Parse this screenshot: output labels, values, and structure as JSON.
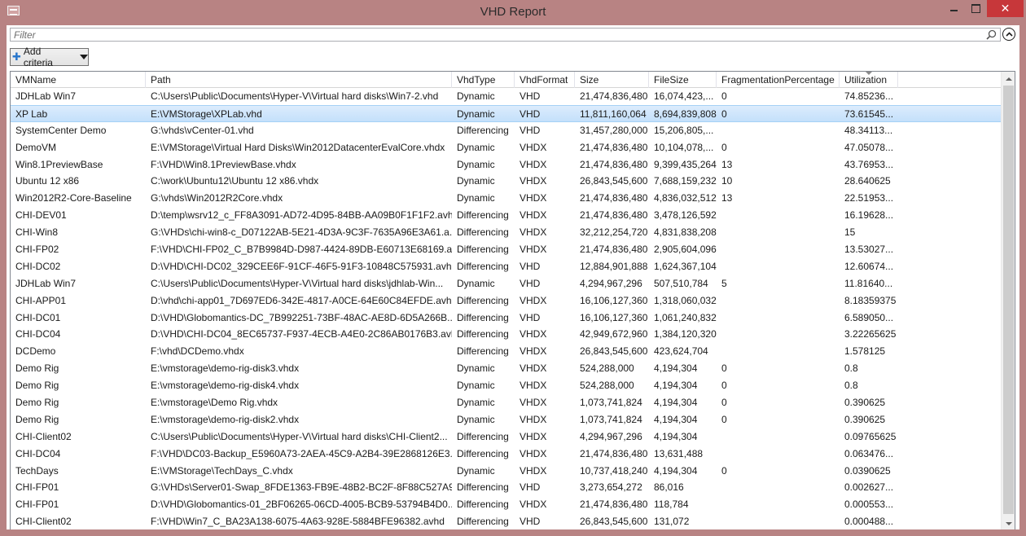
{
  "window": {
    "title": "VHD Report"
  },
  "filter": {
    "placeholder": "Filter",
    "value": ""
  },
  "toolbar": {
    "add_criteria_label": "Add criteria"
  },
  "columns": [
    "VMName",
    "Path",
    "VhdType",
    "VhdFormat",
    "Size",
    "FileSize",
    "FragmentationPercentage",
    "Utilization"
  ],
  "sort": {
    "column": "Utilization",
    "direction": "descending"
  },
  "selected_row_index": 1,
  "rows": [
    [
      "JDHLab Win7",
      "C:\\Users\\Public\\Documents\\Hyper-V\\Virtual hard disks\\Win7-2.vhd",
      "Dynamic",
      "VHD",
      "21,474,836,480",
      "16,074,423,...",
      "0",
      "74.85236..."
    ],
    [
      "XP Lab",
      "E:\\VMStorage\\XPLab.vhd",
      "Dynamic",
      "VHD",
      "11,811,160,064",
      "8,694,839,808",
      "0",
      "73.61545..."
    ],
    [
      "SystemCenter Demo",
      "G:\\vhds\\vCenter-01.vhd",
      "Differencing",
      "VHD",
      "31,457,280,000",
      "15,206,805,...",
      "",
      "48.34113..."
    ],
    [
      "DemoVM",
      "E:\\VMStorage\\Virtual Hard Disks\\Win2012DatacenterEvalCore.vhdx",
      "Dynamic",
      "VHDX",
      "21,474,836,480",
      "10,104,078,...",
      "0",
      "47.05078..."
    ],
    [
      "Win8.1PreviewBase",
      "F:\\VHD\\Win8.1PreviewBase.vhdx",
      "Dynamic",
      "VHDX",
      "21,474,836,480",
      "9,399,435,264",
      "13",
      "43.76953..."
    ],
    [
      "Ubuntu 12 x86",
      "C:\\work\\Ubuntu12\\Ubuntu 12 x86.vhdx",
      "Dynamic",
      "VHDX",
      "26,843,545,600",
      "7,688,159,232",
      "10",
      "28.640625"
    ],
    [
      "Win2012R2-Core-Baseline",
      "G:\\vhds\\Win2012R2Core.vhdx",
      "Dynamic",
      "VHDX",
      "21,474,836,480",
      "4,836,032,512",
      "13",
      "22.51953..."
    ],
    [
      "CHI-DEV01",
      "D:\\temp\\wsrv12_c_FF8A3091-AD72-4D95-84BB-AA09B0F1F1F2.avh...",
      "Differencing",
      "VHDX",
      "21,474,836,480",
      "3,478,126,592",
      "",
      "16.19628..."
    ],
    [
      "CHI-Win8",
      "G:\\VHDs\\chi-win8-c_D07122AB-5E21-4D3A-9C3F-7635A96E3A61.a...",
      "Differencing",
      "VHDX",
      "32,212,254,720",
      "4,831,838,208",
      "",
      "15"
    ],
    [
      "CHI-FP02",
      "F:\\VHD\\CHI-FP02_C_B7B9984D-D987-4424-89DB-E60713E68169.a...",
      "Differencing",
      "VHDX",
      "21,474,836,480",
      "2,905,604,096",
      "",
      "13.53027..."
    ],
    [
      "CHI-DC02",
      "D:\\VHD\\CHI-DC02_329CEE6F-91CF-46F5-91F3-10848C575931.avhd",
      "Differencing",
      "VHD",
      "12,884,901,888",
      "1,624,367,104",
      "",
      "12.60674..."
    ],
    [
      "JDHLab Win7",
      "C:\\Users\\Public\\Documents\\Hyper-V\\Virtual hard disks\\jdhlab-Win...",
      "Dynamic",
      "VHD",
      "4,294,967,296",
      "507,510,784",
      "5",
      "11.81640..."
    ],
    [
      "CHI-APP01",
      "D:\\vhd\\chi-app01_7D697ED6-342E-4817-A0CE-64E60C84EFDE.avhdx",
      "Differencing",
      "VHDX",
      "16,106,127,360",
      "1,318,060,032",
      "",
      "8.18359375"
    ],
    [
      "CHI-DC01",
      "D:\\VHD\\Globomantics-DC_7B992251-73BF-48AC-AE8D-6D5A266B...",
      "Differencing",
      "VHD",
      "16,106,127,360",
      "1,061,240,832",
      "",
      "6.589050..."
    ],
    [
      "CHI-DC04",
      "D:\\VHD\\CHI-DC04_8EC65737-F937-4ECB-A4E0-2C86AB0176B3.avh...",
      "Differencing",
      "VHDX",
      "42,949,672,960",
      "1,384,120,320",
      "",
      "3.22265625"
    ],
    [
      "DCDemo",
      "F:\\vhd\\DCDemo.vhdx",
      "Differencing",
      "VHDX",
      "26,843,545,600",
      "423,624,704",
      "",
      "1.578125"
    ],
    [
      "Demo Rig",
      "E:\\vmstorage\\demo-rig-disk3.vhdx",
      "Dynamic",
      "VHDX",
      "524,288,000",
      "4,194,304",
      "0",
      "0.8"
    ],
    [
      "Demo Rig",
      "E:\\vmstorage\\demo-rig-disk4.vhdx",
      "Dynamic",
      "VHDX",
      "524,288,000",
      "4,194,304",
      "0",
      "0.8"
    ],
    [
      "Demo Rig",
      "E:\\vmstorage\\Demo Rig.vhdx",
      "Dynamic",
      "VHDX",
      "1,073,741,824",
      "4,194,304",
      "0",
      "0.390625"
    ],
    [
      "Demo Rig",
      "E:\\vmstorage\\demo-rig-disk2.vhdx",
      "Dynamic",
      "VHDX",
      "1,073,741,824",
      "4,194,304",
      "0",
      "0.390625"
    ],
    [
      "CHI-Client02",
      "C:\\Users\\Public\\Documents\\Hyper-V\\Virtual hard disks\\CHI-Client2...",
      "Differencing",
      "VHDX",
      "4,294,967,296",
      "4,194,304",
      "",
      "0.09765625"
    ],
    [
      "CHI-DC04",
      "F:\\VHD\\DC03-Backup_E5960A73-2AEA-45C9-A2B4-39E2868126E3....",
      "Differencing",
      "VHDX",
      "21,474,836,480",
      "13,631,488",
      "",
      "0.063476..."
    ],
    [
      "TechDays",
      "E:\\VMStorage\\TechDays_C.vhdx",
      "Dynamic",
      "VHDX",
      "10,737,418,240",
      "4,194,304",
      "0",
      "0.0390625"
    ],
    [
      "CHI-FP01",
      "G:\\VHDs\\Server01-Swap_8FDE1363-FB9E-48B2-BC2F-8F88C527A9...",
      "Differencing",
      "VHD",
      "3,273,654,272",
      "86,016",
      "",
      "0.002627..."
    ],
    [
      "CHI-FP01",
      "D:\\VHD\\Globomantics-01_2BF06265-06CD-4005-BCB9-53794B4D0...",
      "Differencing",
      "VHDX",
      "21,474,836,480",
      "118,784",
      "",
      "0.000553..."
    ],
    [
      "CHI-Client02",
      "F:\\VHD\\Win7_C_BA23A138-6075-4A63-928E-5884BFE96382.avhd",
      "Differencing",
      "VHD",
      "26,843,545,600",
      "131,072",
      "",
      "0.000488..."
    ]
  ]
}
